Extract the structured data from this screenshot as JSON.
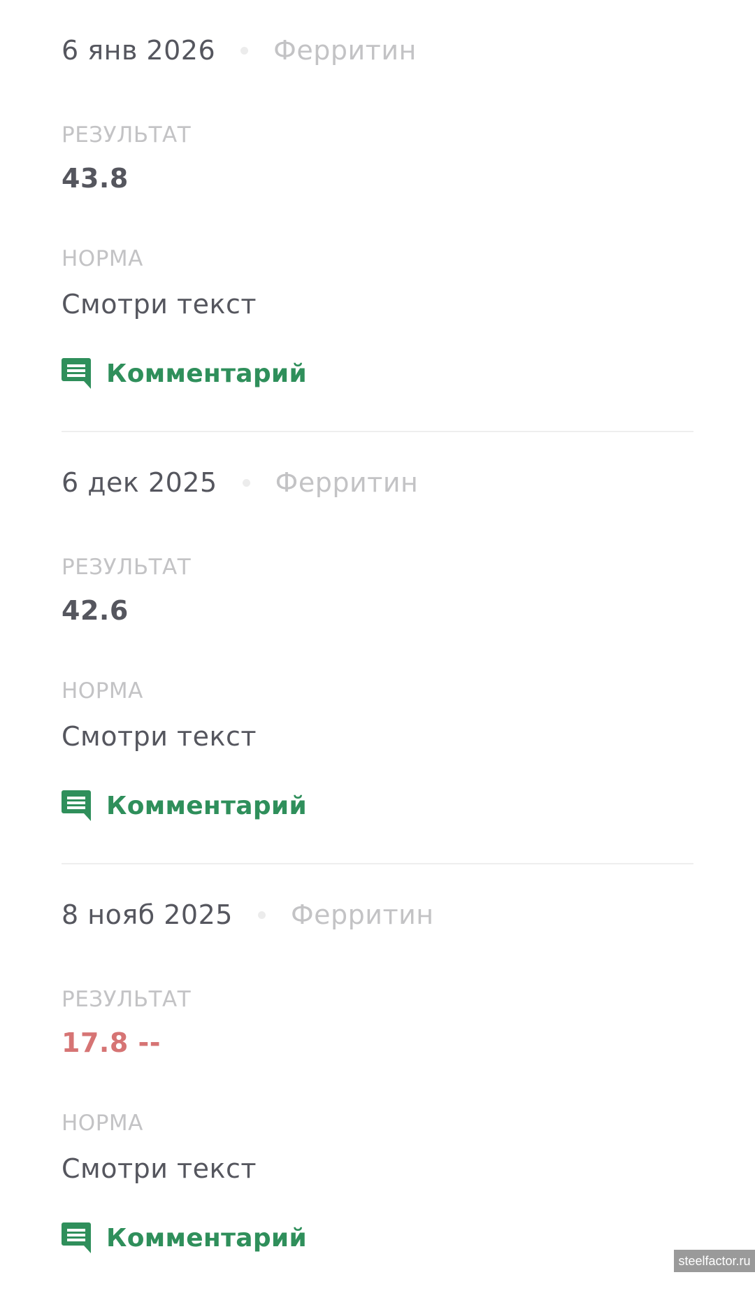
{
  "entries": [
    {
      "date": "6 янв 2026",
      "test": "Ферритин",
      "result_label": "РЕЗУЛЬТАТ",
      "result_value": "43.8",
      "norm_label": "НОРМА",
      "norm_value": "Смотри текст",
      "comment_label": "Комментарий"
    },
    {
      "date": "6 дек 2025",
      "test": "Ферритин",
      "result_label": "РЕЗУЛЬТАТ",
      "result_value": "42.6",
      "norm_label": "НОРМА",
      "norm_value": "Смотри текст",
      "comment_label": "Комментарий"
    },
    {
      "date": "8 нояб 2025",
      "test": "Ферритин",
      "result_label": "РЕЗУЛЬТАТ",
      "result_value": "17.8 --",
      "result_status": "low",
      "norm_label": "НОРМА",
      "norm_value": "Смотри текст",
      "comment_label": "Комментарий"
    }
  ],
  "icons": {
    "comment": "comment-icon"
  },
  "colors": {
    "accent": "#2f8f5b",
    "abnormal": "#d67474",
    "text": "#55565e",
    "muted": "#c3c3c5"
  },
  "watermark": "steelfactor.ru"
}
